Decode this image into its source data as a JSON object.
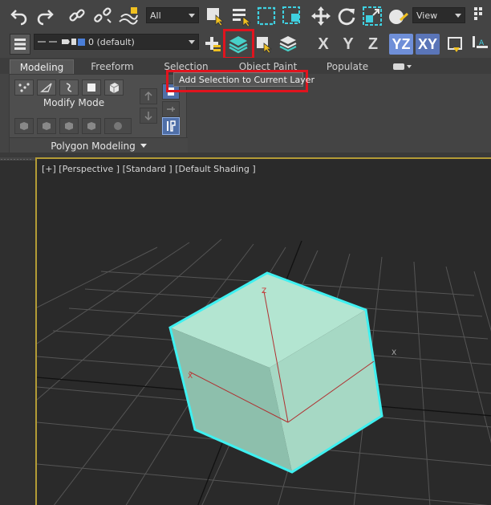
{
  "toolbar": {
    "selection_filter": "All",
    "coord_system": "View",
    "layer": "0 (default)",
    "axes": [
      "X",
      "Y",
      "Z",
      "YZ",
      "XY"
    ]
  },
  "ribbon": {
    "tabs": [
      "Modeling",
      "Freeform",
      "Selection",
      "Object Paint",
      "Populate"
    ],
    "modify_mode": "Modify Mode",
    "polygon_modeling": "Polygon Modeling"
  },
  "tooltip": "Add Selection to Current Layer",
  "viewport": {
    "label": "[+] [Perspective ] [Standard ] [Default Shading ]",
    "gizmo_x": "X",
    "gizmo_z": "Z",
    "grid_x": "X"
  },
  "colors": {
    "accent_highlight": "#e0141e",
    "cube_fill": "#a8dcc8",
    "cube_outline": "#3ff0f0",
    "viewport_border": "#b39b36",
    "active_axis": "#6f8fd8"
  }
}
